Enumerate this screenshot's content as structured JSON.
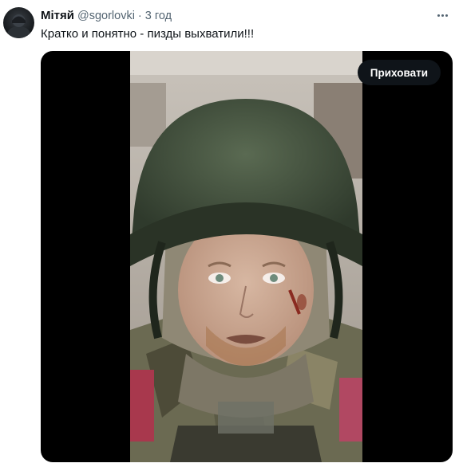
{
  "tweet": {
    "author_name": "Мітяй",
    "handle": "@sgorlovki",
    "separator": "·",
    "time": "3 год",
    "text": "Кратко и понятно - пизды выхватили!!!"
  },
  "media": {
    "hide_button_label": "Приховати"
  },
  "icons": {
    "more": "more-options-icon",
    "avatar": "avatar"
  },
  "colors": {
    "text_primary": "#0f1419",
    "text_secondary": "#536471",
    "button_bg": "#0f1419",
    "button_text": "#ffffff"
  }
}
